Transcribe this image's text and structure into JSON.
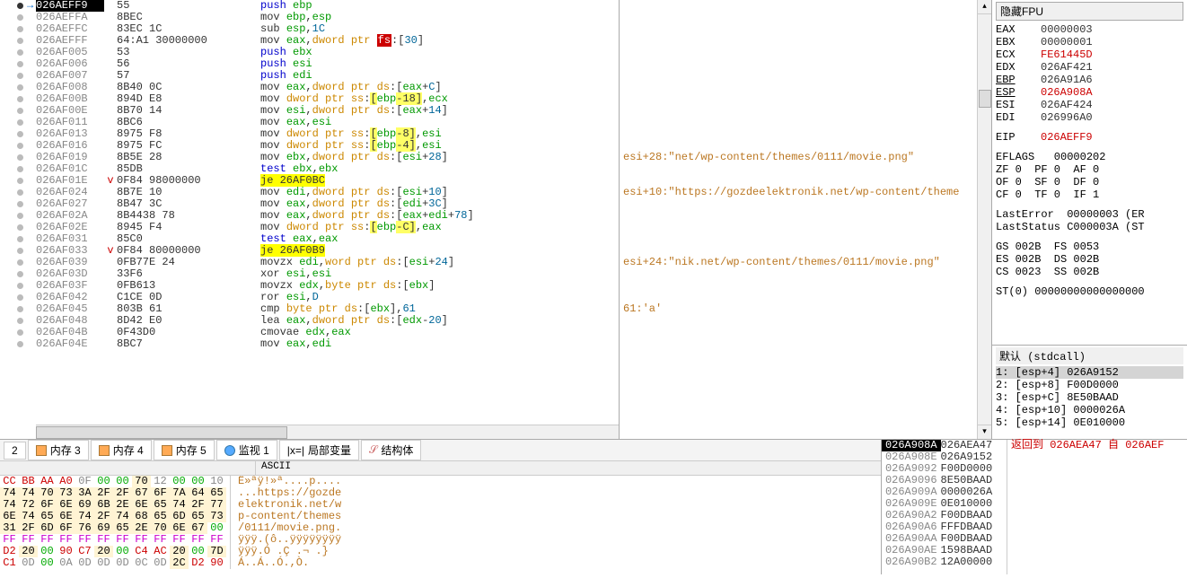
{
  "disasm": [
    {
      "bp": "on",
      "arrow": "→",
      "addr": "026AEFF9",
      "sel": true,
      "bytes": "55",
      "marker": "",
      "instr": [
        [
          "mn-push",
          "push "
        ],
        [
          "reg",
          "ebp"
        ]
      ]
    },
    {
      "bp": "off",
      "addr": "026AEFFA",
      "bytes": "8BEC",
      "instr": [
        [
          "mn-mov",
          "mov "
        ],
        [
          "reg",
          "ebp"
        ],
        [
          "",
          ","
        ],
        [
          "reg",
          "esp"
        ]
      ]
    },
    {
      "bp": "off",
      "addr": "026AEFFC",
      "bytes": "83EC 1C",
      "instr": [
        [
          "mn-sub",
          "sub "
        ],
        [
          "reg",
          "esp"
        ],
        [
          "",
          ","
        ],
        [
          "num",
          "1C"
        ]
      ]
    },
    {
      "bp": "off",
      "addr": "026AEFFF",
      "bytes": "64:A1 30000000",
      "instr": [
        [
          "mn-mov",
          "mov "
        ],
        [
          "reg",
          "eax"
        ],
        [
          "",
          ","
        ],
        [
          "ptr-kw",
          "dword ptr "
        ],
        [
          "seg-fs",
          "fs"
        ],
        [
          "",
          ":"
        ],
        [
          "brkt",
          "["
        ],
        [
          "num",
          "30"
        ],
        [
          "brkt",
          "]"
        ]
      ]
    },
    {
      "bp": "off",
      "addr": "026AF005",
      "bytes": "53",
      "instr": [
        [
          "mn-push",
          "push "
        ],
        [
          "reg",
          "ebx"
        ]
      ]
    },
    {
      "bp": "off",
      "addr": "026AF006",
      "bytes": "56",
      "instr": [
        [
          "mn-push",
          "push "
        ],
        [
          "reg",
          "esi"
        ]
      ]
    },
    {
      "bp": "off",
      "addr": "026AF007",
      "bytes": "57",
      "instr": [
        [
          "mn-push",
          "push "
        ],
        [
          "reg",
          "edi"
        ]
      ]
    },
    {
      "bp": "off",
      "addr": "026AF008",
      "bytes": "8B40 0C",
      "instr": [
        [
          "mn-mov",
          "mov "
        ],
        [
          "reg",
          "eax"
        ],
        [
          "",
          ","
        ],
        [
          "ptr-kw",
          "dword ptr "
        ],
        [
          "seg-ds",
          "ds"
        ],
        [
          "",
          ":"
        ],
        [
          "brkt",
          "["
        ],
        [
          "reg",
          "eax"
        ],
        [
          "",
          "+"
        ],
        [
          "num",
          "C"
        ],
        [
          "brkt",
          "]"
        ]
      ]
    },
    {
      "bp": "off",
      "addr": "026AF00B",
      "bytes": "894D E8",
      "instr": [
        [
          "mn-mov",
          "mov "
        ],
        [
          "ptr-kw",
          "dword ptr "
        ],
        [
          "seg-ss",
          "ss"
        ],
        [
          "",
          ":"
        ],
        [
          "mem-hl",
          "["
        ],
        [
          "reg",
          "ebp"
        ],
        [
          "mem-hl",
          "-18]"
        ],
        [
          "",
          ","
        ],
        [
          "reg",
          "ecx"
        ]
      ]
    },
    {
      "bp": "off",
      "addr": "026AF00E",
      "bytes": "8B70 14",
      "instr": [
        [
          "mn-mov",
          "mov "
        ],
        [
          "reg",
          "esi"
        ],
        [
          "",
          ","
        ],
        [
          "ptr-kw",
          "dword ptr "
        ],
        [
          "seg-ds",
          "ds"
        ],
        [
          "",
          ":"
        ],
        [
          "brkt",
          "["
        ],
        [
          "reg",
          "eax"
        ],
        [
          "",
          "+"
        ],
        [
          "num",
          "14"
        ],
        [
          "brkt",
          "]"
        ]
      ]
    },
    {
      "bp": "off",
      "addr": "026AF011",
      "bytes": "8BC6",
      "instr": [
        [
          "mn-mov",
          "mov "
        ],
        [
          "reg",
          "eax"
        ],
        [
          "",
          ","
        ],
        [
          "reg",
          "esi"
        ]
      ]
    },
    {
      "bp": "off",
      "addr": "026AF013",
      "bytes": "8975 F8",
      "instr": [
        [
          "mn-mov",
          "mov "
        ],
        [
          "ptr-kw",
          "dword ptr "
        ],
        [
          "seg-ss",
          "ss"
        ],
        [
          "",
          ":"
        ],
        [
          "mem-hl",
          "["
        ],
        [
          "reg",
          "ebp"
        ],
        [
          "mem-hl",
          "-8]"
        ],
        [
          "",
          ","
        ],
        [
          "reg",
          "esi"
        ]
      ]
    },
    {
      "bp": "off",
      "addr": "026AF016",
      "bytes": "8975 FC",
      "instr": [
        [
          "mn-mov",
          "mov "
        ],
        [
          "ptr-kw",
          "dword ptr "
        ],
        [
          "seg-ss",
          "ss"
        ],
        [
          "",
          ":"
        ],
        [
          "mem-hl",
          "["
        ],
        [
          "reg",
          "ebp"
        ],
        [
          "mem-hl",
          "-4]"
        ],
        [
          "",
          ","
        ],
        [
          "reg",
          "esi"
        ]
      ]
    },
    {
      "bp": "off",
      "addr": "026AF019",
      "bytes": "8B5E 28",
      "instr": [
        [
          "mn-mov",
          "mov "
        ],
        [
          "reg",
          "ebx"
        ],
        [
          "",
          ","
        ],
        [
          "ptr-kw",
          "dword ptr "
        ],
        [
          "seg-ds",
          "ds"
        ],
        [
          "",
          ":"
        ],
        [
          "brkt",
          "["
        ],
        [
          "reg",
          "esi"
        ],
        [
          "",
          "+"
        ],
        [
          "num",
          "28"
        ],
        [
          "brkt",
          "]"
        ]
      ]
    },
    {
      "bp": "off",
      "addr": "026AF01C",
      "bytes": "85DB",
      "instr": [
        [
          "mn-test",
          "test "
        ],
        [
          "reg",
          "ebx"
        ],
        [
          "",
          ","
        ],
        [
          "reg",
          "ebx"
        ]
      ]
    },
    {
      "bp": "off",
      "addr": "026AF01E",
      "bytes": "0F84 98000000",
      "marker": "v",
      "instr": [
        [
          "jmp-tgt",
          "je 26AF0BC"
        ]
      ]
    },
    {
      "bp": "off",
      "addr": "026AF024",
      "bytes": "8B7E 10",
      "instr": [
        [
          "mn-mov",
          "mov "
        ],
        [
          "reg",
          "edi"
        ],
        [
          "",
          ","
        ],
        [
          "ptr-kw",
          "dword ptr "
        ],
        [
          "seg-ds",
          "ds"
        ],
        [
          "",
          ":"
        ],
        [
          "brkt",
          "["
        ],
        [
          "reg",
          "esi"
        ],
        [
          "",
          "+"
        ],
        [
          "num",
          "10"
        ],
        [
          "brkt",
          "]"
        ]
      ]
    },
    {
      "bp": "off",
      "addr": "026AF027",
      "bytes": "8B47 3C",
      "instr": [
        [
          "mn-mov",
          "mov "
        ],
        [
          "reg",
          "eax"
        ],
        [
          "",
          ","
        ],
        [
          "ptr-kw",
          "dword ptr "
        ],
        [
          "seg-ds",
          "ds"
        ],
        [
          "",
          ":"
        ],
        [
          "brkt",
          "["
        ],
        [
          "reg",
          "edi"
        ],
        [
          "",
          "+"
        ],
        [
          "num",
          "3C"
        ],
        [
          "brkt",
          "]"
        ]
      ]
    },
    {
      "bp": "off",
      "addr": "026AF02A",
      "bytes": "8B4438 78",
      "instr": [
        [
          "mn-mov",
          "mov "
        ],
        [
          "reg",
          "eax"
        ],
        [
          "",
          ","
        ],
        [
          "ptr-kw",
          "dword ptr "
        ],
        [
          "seg-ds",
          "ds"
        ],
        [
          "",
          ":"
        ],
        [
          "brkt",
          "["
        ],
        [
          "reg",
          "eax"
        ],
        [
          "",
          "+"
        ],
        [
          "reg",
          "edi"
        ],
        [
          "",
          "+"
        ],
        [
          "num",
          "78"
        ],
        [
          "brkt",
          "]"
        ]
      ]
    },
    {
      "bp": "off",
      "addr": "026AF02E",
      "bytes": "8945 F4",
      "instr": [
        [
          "mn-mov",
          "mov "
        ],
        [
          "ptr-kw",
          "dword ptr "
        ],
        [
          "seg-ss",
          "ss"
        ],
        [
          "",
          ":"
        ],
        [
          "mem-hl",
          "["
        ],
        [
          "reg",
          "ebp"
        ],
        [
          "mem-hl",
          "-C]"
        ],
        [
          "",
          ","
        ],
        [
          "reg",
          "eax"
        ]
      ]
    },
    {
      "bp": "off",
      "addr": "026AF031",
      "bytes": "85C0",
      "instr": [
        [
          "mn-test",
          "test "
        ],
        [
          "reg",
          "eax"
        ],
        [
          "",
          ","
        ],
        [
          "reg",
          "eax"
        ]
      ]
    },
    {
      "bp": "off",
      "addr": "026AF033",
      "bytes": "0F84 80000000",
      "marker": "v",
      "instr": [
        [
          "jmp-tgt",
          "je 26AF0B9"
        ]
      ]
    },
    {
      "bp": "off",
      "addr": "026AF039",
      "bytes": "0FB77E 24",
      "instr": [
        [
          "mn-movzx",
          "movzx "
        ],
        [
          "reg",
          "edi"
        ],
        [
          "",
          ","
        ],
        [
          "ptr-kw",
          "word ptr "
        ],
        [
          "seg-ds",
          "ds"
        ],
        [
          "",
          ":"
        ],
        [
          "brkt",
          "["
        ],
        [
          "reg",
          "esi"
        ],
        [
          "",
          "+"
        ],
        [
          "num",
          "24"
        ],
        [
          "brkt",
          "]"
        ]
      ]
    },
    {
      "bp": "off",
      "addr": "026AF03D",
      "bytes": "33F6",
      "instr": [
        [
          "mn-xor",
          "xor "
        ],
        [
          "reg",
          "esi"
        ],
        [
          "",
          ","
        ],
        [
          "reg",
          "esi"
        ]
      ]
    },
    {
      "bp": "off",
      "addr": "026AF03F",
      "bytes": "0FB613",
      "instr": [
        [
          "mn-movzx",
          "movzx "
        ],
        [
          "reg",
          "edx"
        ],
        [
          "",
          ","
        ],
        [
          "ptr-kw",
          "byte ptr "
        ],
        [
          "seg-ds",
          "ds"
        ],
        [
          "",
          ":"
        ],
        [
          "brkt",
          "["
        ],
        [
          "reg",
          "ebx"
        ],
        [
          "brkt",
          "]"
        ]
      ]
    },
    {
      "bp": "off",
      "addr": "026AF042",
      "bytes": "C1CE 0D",
      "instr": [
        [
          "mn-ror",
          "ror "
        ],
        [
          "reg",
          "esi"
        ],
        [
          "",
          ","
        ],
        [
          "num",
          "D"
        ]
      ]
    },
    {
      "bp": "off",
      "addr": "026AF045",
      "bytes": "803B 61",
      "instr": [
        [
          "mn-cmp",
          "cmp "
        ],
        [
          "ptr-kw",
          "byte ptr "
        ],
        [
          "seg-ds",
          "ds"
        ],
        [
          "",
          ":"
        ],
        [
          "brkt",
          "["
        ],
        [
          "reg",
          "ebx"
        ],
        [
          "brkt",
          "]"
        ],
        [
          "",
          ","
        ],
        [
          "num",
          "61"
        ]
      ]
    },
    {
      "bp": "off",
      "addr": "026AF048",
      "bytes": "8D42 E0",
      "instr": [
        [
          "mn-lea",
          "lea "
        ],
        [
          "reg",
          "eax"
        ],
        [
          "",
          ","
        ],
        [
          "ptr-kw",
          "dword ptr "
        ],
        [
          "seg-ds",
          "ds"
        ],
        [
          "",
          ":"
        ],
        [
          "brkt",
          "["
        ],
        [
          "reg",
          "edx"
        ],
        [
          "",
          "-"
        ],
        [
          "num",
          "20"
        ],
        [
          "brkt",
          "]"
        ]
      ]
    },
    {
      "bp": "off",
      "addr": "026AF04B",
      "bytes": "0F43D0",
      "instr": [
        [
          "mn-cmovae",
          "cmovae "
        ],
        [
          "reg",
          "edx"
        ],
        [
          "",
          ","
        ],
        [
          "reg",
          "eax"
        ]
      ]
    },
    {
      "bp": "off",
      "addr": "026AF04E",
      "bytes": "8BC7",
      "instr": [
        [
          "mn-mov",
          "mov "
        ],
        [
          "reg",
          "eax"
        ],
        [
          "",
          ","
        ],
        [
          "reg",
          "edi"
        ]
      ]
    }
  ],
  "comments": {
    "13": "esi+28:\"net/wp-content/themes/0111/movie.png\"",
    "16": "esi+10:\"https://gozdeelektronik.net/wp-content/theme",
    "22": "esi+24:\"nik.net/wp-content/themes/0111/movie.png\"",
    "26": "61:'a'"
  },
  "registers": {
    "header": "隐藏FPU",
    "gpr": [
      {
        "name": "EAX",
        "val": "00000003"
      },
      {
        "name": "EBX",
        "val": "00000001"
      },
      {
        "name": "ECX",
        "val": "FE61445D",
        "red": true
      },
      {
        "name": "EDX",
        "val": "026AF421"
      },
      {
        "name": "EBP",
        "val": "026A91A6",
        "ul": true
      },
      {
        "name": "ESP",
        "val": "026A908A",
        "red": true,
        "ul": true
      },
      {
        "name": "ESI",
        "val": "026AF424"
      },
      {
        "name": "EDI",
        "val": "026996A0"
      }
    ],
    "eip": {
      "name": "EIP",
      "val": "026AEFF9",
      "red": true
    },
    "eflags": "EFLAGS   00000202",
    "flag_rows": [
      "ZF 0  PF 0  AF 0",
      "OF 0  SF 0  DF 0",
      "CF 0  TF 0  IF 1"
    ],
    "lasterr": "LastError  00000003 (ER",
    "laststat": "LastStatus C000003A (ST",
    "segs": [
      "GS 002B  FS 0053",
      "ES 002B  DS 002B",
      "CS 0023  SS 002B"
    ],
    "fpu0": "ST(0) 00000000000000000"
  },
  "args": {
    "header": "默认 (stdcall)",
    "items": [
      "1: [esp+4] 026A9152",
      "2: [esp+8] F00D0000",
      "3: [esp+C] 8E50BAAD",
      "4: [esp+10] 0000026A",
      "5: [esp+14] 0E010000"
    ]
  },
  "tabs": {
    "t2_label": "2",
    "mem3": "内存 3",
    "mem4": "内存 4",
    "mem5": "内存 5",
    "watch": "监视 1",
    "locals": "局部变量",
    "struct": "结构体"
  },
  "dump_ascii_header": "ASCII",
  "dump_lines": [
    {
      "hex": "CC BB AA A0 0F 00 00 70 12 00 00 10",
      "ascii": "Ë»ªÿ!»ª....p...."
    },
    {
      "hex": "74 74 70 73 3A 2F 2F 67 6F 7A 64 65",
      "ascii": "...https://gozde"
    },
    {
      "hex": "74 72 6F 6E 69 6B 2E 6E 65 74 2F 77",
      "ascii": "elektronik.net/w"
    },
    {
      "hex": "6E 74 65 6E 74 2F 74 68 65 6D 65 73",
      "ascii": "p-content/themes"
    },
    {
      "hex": "31 2F 6D 6F 76 69 65 2E 70 6E 67 00",
      "ascii": "/0111/movie.png."
    },
    {
      "hex": "FF FF FF FF FF FF FF FF FF FF FF FF",
      "ascii": "ÿÿÿ.(ô..ÿÿÿÿÿÿÿÿ"
    },
    {
      "hex": "D2 20 00 90 C7 20 00 C4 AC 20 00 7D",
      "ascii": "ÿÿÿ.Ó .Ç .¬ .}"
    },
    {
      "hex": "C1 0D 00 0A 0D 0D 0D 0C 0D 2C D2 90",
      "ascii": "Á..Á..Ó.,Ò."
    }
  ],
  "stack": [
    {
      "addr": "026A908A",
      "sel": true,
      "val": "026AEA47",
      "comment": "返回到 026AEA47 自 026AEF"
    },
    {
      "addr": "026A908E",
      "val": "026A9152"
    },
    {
      "addr": "026A9092",
      "val": "F00D0000"
    },
    {
      "addr": "026A9096",
      "val": "8E50BAAD"
    },
    {
      "addr": "026A909A",
      "val": "0000026A"
    },
    {
      "addr": "026A909E",
      "val": "0E010000"
    },
    {
      "addr": "026A90A2",
      "val": "F00DBAAD"
    },
    {
      "addr": "026A90A6",
      "val": "FFFDBAAD"
    },
    {
      "addr": "026A90AA",
      "val": "F00DBAAD"
    },
    {
      "addr": "026A90AE",
      "val": "1598BAAD"
    },
    {
      "addr": "026A90B2",
      "val": "12A00000"
    }
  ]
}
